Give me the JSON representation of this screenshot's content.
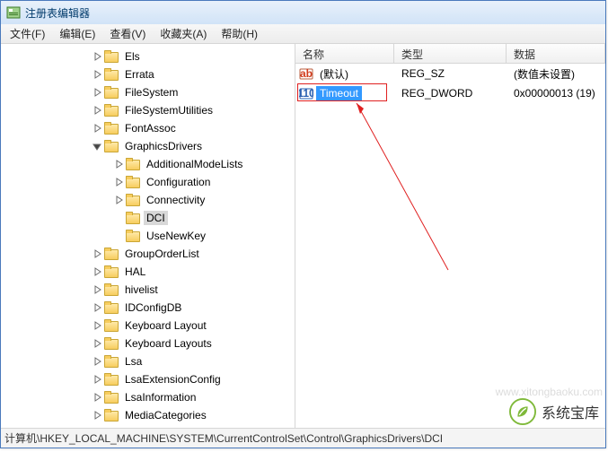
{
  "window": {
    "title": "注册表编辑器"
  },
  "menus": {
    "file": "文件(F)",
    "edit": "编辑(E)",
    "view": "查看(V)",
    "fav": "收藏夹(A)",
    "help": "帮助(H)"
  },
  "tree": {
    "items": [
      {
        "indent": 100,
        "tw": "closed",
        "label": "Els"
      },
      {
        "indent": 100,
        "tw": "closed",
        "label": "Errata"
      },
      {
        "indent": 100,
        "tw": "closed",
        "label": "FileSystem"
      },
      {
        "indent": 100,
        "tw": "closed",
        "label": "FileSystemUtilities"
      },
      {
        "indent": 100,
        "tw": "closed",
        "label": "FontAssoc"
      },
      {
        "indent": 100,
        "tw": "open",
        "label": "GraphicsDrivers"
      },
      {
        "indent": 124,
        "tw": "closed",
        "label": "AdditionalModeLists"
      },
      {
        "indent": 124,
        "tw": "closed",
        "label": "Configuration"
      },
      {
        "indent": 124,
        "tw": "closed",
        "label": "Connectivity"
      },
      {
        "indent": 124,
        "tw": "none",
        "label": "DCI",
        "selected": true
      },
      {
        "indent": 124,
        "tw": "none",
        "label": "UseNewKey"
      },
      {
        "indent": 100,
        "tw": "closed",
        "label": "GroupOrderList"
      },
      {
        "indent": 100,
        "tw": "closed",
        "label": "HAL"
      },
      {
        "indent": 100,
        "tw": "closed",
        "label": "hivelist"
      },
      {
        "indent": 100,
        "tw": "closed",
        "label": "IDConfigDB"
      },
      {
        "indent": 100,
        "tw": "closed",
        "label": "Keyboard Layout"
      },
      {
        "indent": 100,
        "tw": "closed",
        "label": "Keyboard Layouts"
      },
      {
        "indent": 100,
        "tw": "closed",
        "label": "Lsa"
      },
      {
        "indent": 100,
        "tw": "closed",
        "label": "LsaExtensionConfig"
      },
      {
        "indent": 100,
        "tw": "closed",
        "label": "LsaInformation"
      },
      {
        "indent": 100,
        "tw": "closed",
        "label": "MediaCategories"
      }
    ]
  },
  "columns": {
    "name": "名称",
    "type": "类型",
    "data": "数据",
    "w_name": 110,
    "w_type": 125,
    "w_data": 110
  },
  "values": [
    {
      "icon": "str",
      "name": "(默认)",
      "type": "REG_SZ",
      "data": "(数值未设置)",
      "selected": false
    },
    {
      "icon": "bin",
      "name": "Timeout",
      "type": "REG_DWORD",
      "data": "0x00000013 (19)",
      "selected": true
    }
  ],
  "status": {
    "path": "计算机\\HKEY_LOCAL_MACHINE\\SYSTEM\\CurrentControlSet\\Control\\GraphicsDrivers\\DCI"
  },
  "branding": {
    "watermark": "www.xitongbaoku.com",
    "logo_text": "系统宝库"
  }
}
